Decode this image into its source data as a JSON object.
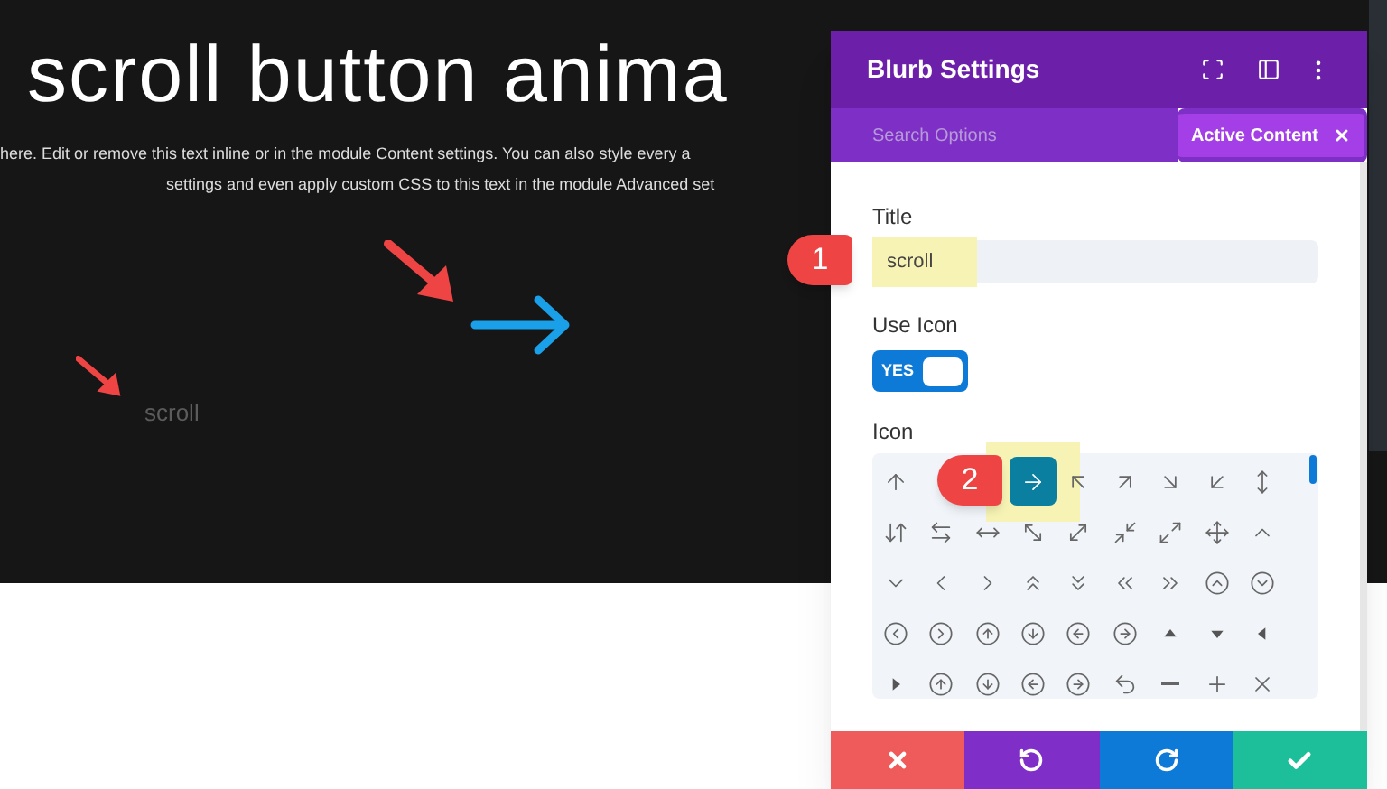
{
  "page": {
    "heading": "scroll button anima",
    "body_lines": [
      "here. Edit or remove this text inline or in the module Content settings. You can also style every a",
      "settings and even apply custom CSS to this text in the module Advanced set"
    ],
    "blurb_title": "scroll"
  },
  "callouts": [
    {
      "text": "1"
    },
    {
      "text": "2"
    }
  ],
  "panel": {
    "title": "Blurb Settings",
    "search": {
      "placeholder": "Search Options"
    },
    "filter_chip": "Active Content",
    "title_label": "Title",
    "title_value": "scroll",
    "use_icon_label": "Use Icon",
    "use_icon": {
      "on": true,
      "text": "YES"
    },
    "icon_label": "Icon",
    "icon_rows": [
      [
        {
          "selected": false
        },
        {
          "selected": true
        },
        {
          "selected": false
        },
        {
          "selected": false
        },
        {
          "selected": false
        },
        {
          "selected": false
        },
        {
          "selected": false
        }
      ],
      [
        {
          "selected": false
        },
        {
          "selected": false
        },
        {
          "selected": false
        },
        {
          "selected": false
        },
        {
          "selected": false
        },
        {
          "selected": false
        },
        {
          "selected": false
        },
        {
          "selected": false
        },
        {
          "selected": false
        }
      ],
      [
        {
          "selected": false
        },
        {
          "selected": false
        },
        {
          "selected": false
        },
        {
          "selected": false
        },
        {
          "selected": false
        },
        {
          "selected": false
        },
        {
          "selected": false
        },
        {
          "selected": false
        },
        {
          "selected": false
        }
      ],
      [
        {
          "selected": false
        },
        {
          "selected": false
        },
        {
          "selected": false
        },
        {
          "selected": false
        },
        {
          "selected": false
        },
        {
          "selected": false
        },
        {
          "selected": false
        },
        {
          "selected": false
        },
        {
          "selected": false
        }
      ],
      [
        {
          "selected": false
        },
        {
          "selected": false
        },
        {
          "selected": false
        },
        {
          "selected": false
        },
        {
          "selected": false
        },
        {
          "selected": false
        },
        {
          "selected": false
        },
        {
          "selected": false
        },
        {
          "selected": false
        }
      ]
    ]
  }
}
